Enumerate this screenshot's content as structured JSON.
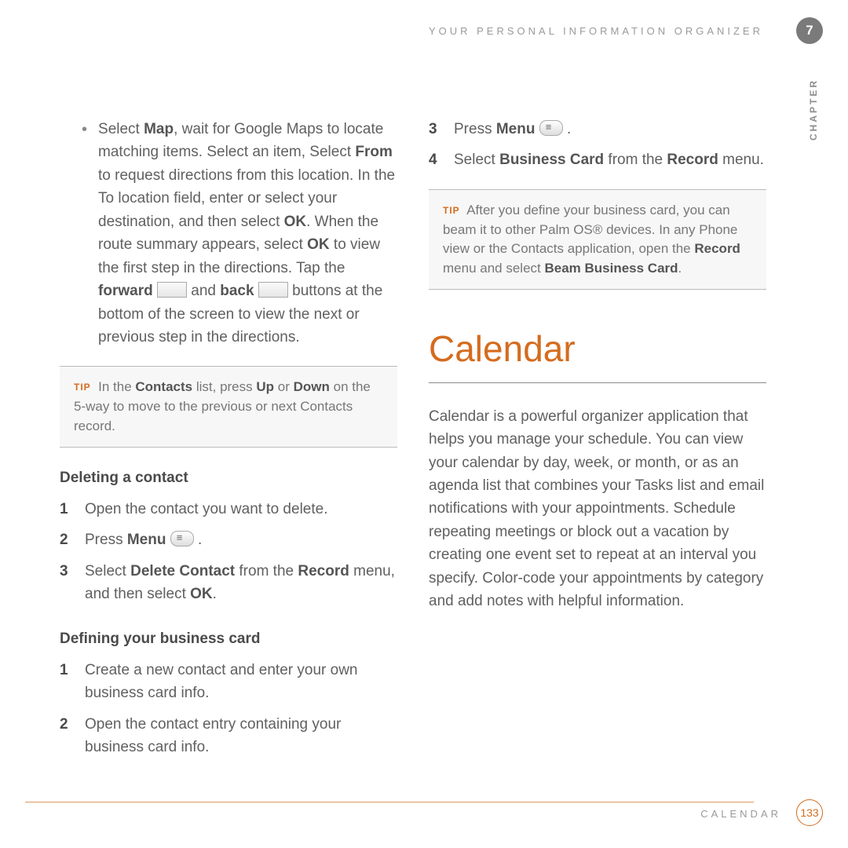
{
  "header": {
    "title": "YOUR PERSONAL INFORMATION ORGANIZER",
    "chapter_number": "7",
    "side_label": "CHAPTER"
  },
  "left": {
    "bullet_prefix": "•",
    "map_paragraph": {
      "t1": "Select ",
      "b1": "Map",
      "t2": ", wait for Google Maps to locate matching items. Select an item, Select ",
      "b2": "From",
      "t3": " to request directions from this location. In the To location field, enter or select your destination, and then select ",
      "b3": "OK",
      "t4": ". When the route summary appears, select ",
      "b4": "OK",
      "t5": " to view the first step in the directions. Tap the ",
      "b5": "forward",
      "icon_fwd_name": "forward-button-icon",
      "t6": " and ",
      "b6": "back",
      "icon_back_name": "back-button-icon",
      "t7": " buttons at the bottom of the screen to view the next or previous step in the directions."
    },
    "tip1": {
      "label": "TIP",
      "t1": "In the ",
      "b1": "Contacts",
      "t2": " list, press ",
      "b2": "Up",
      "t3": " or ",
      "b3": "Down",
      "t4": " on the 5-way to move to the previous or next Contacts record."
    },
    "heading_delete": "Deleting a contact",
    "delete_steps": [
      {
        "n": "1",
        "text": "Open the contact you want to delete."
      },
      {
        "n": "2",
        "t1": "Press ",
        "b1": "Menu",
        "icon": "menu-key-icon",
        "t2": " ."
      },
      {
        "n": "3",
        "t1": "Select ",
        "b1": "Delete Contact",
        "t2": " from the ",
        "b2": "Record",
        "t3": " menu, and then select ",
        "b3": "OK",
        "t4": "."
      }
    ],
    "heading_business": "Defining your business card",
    "business_steps": [
      {
        "n": "1",
        "text": "Create a new contact and enter your own business card info."
      },
      {
        "n": "2",
        "text": "Open the contact entry containing your business card info."
      }
    ]
  },
  "right": {
    "cont_steps": [
      {
        "n": "3",
        "t1": "Press ",
        "b1": "Menu",
        "icon": "menu-key-icon",
        "t2": " ."
      },
      {
        "n": "4",
        "t1": "Select ",
        "b1": "Business Card",
        "t2": " from the ",
        "b2": "Record",
        "t3": " menu."
      }
    ],
    "tip2": {
      "label": "TIP",
      "t1": "After you define your business card, you can beam it to other Palm OS® devices. In any Phone view or the Contacts application, open the ",
      "b1": "Record",
      "t2": " menu and select ",
      "b2": "Beam Business Card",
      "t3": "."
    },
    "section_heading": "Calendar",
    "calendar_body": "Calendar is a powerful organizer application that helps you manage your schedule. You can view your calendar by day, week, or month, or as an agenda list that combines your Tasks list and email notifications with your appointments. Schedule repeating meetings or block out a vacation by creating one event set to repeat at an interval you specify. Color-code your appointments by category and add notes with helpful information."
  },
  "footer": {
    "section": "CALENDAR",
    "page": "133"
  }
}
